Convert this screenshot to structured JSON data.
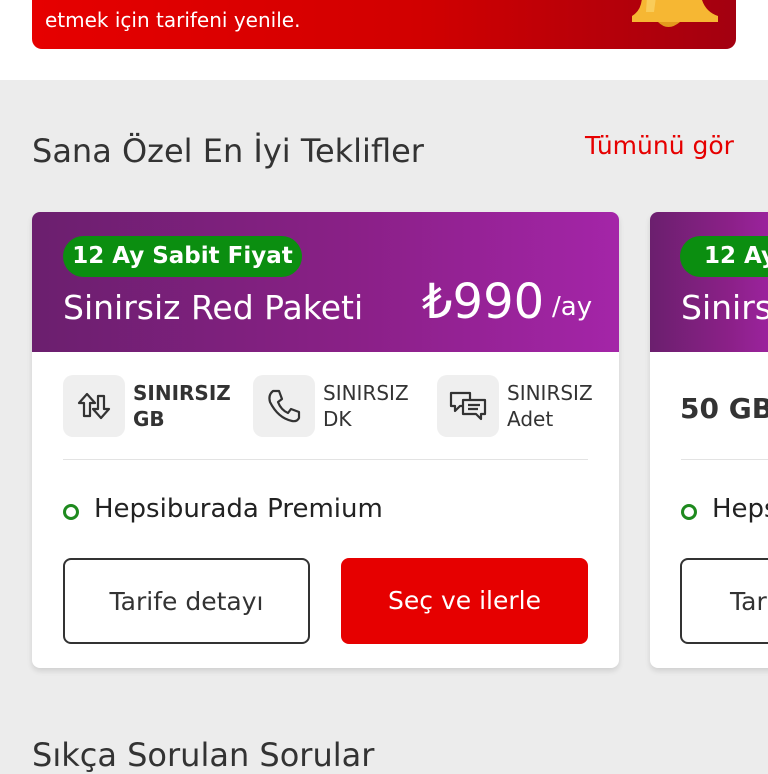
{
  "banner": {
    "text": "etmek için tarifeni yenile."
  },
  "offers": {
    "title": "Sana Özel En İyi Teklifler",
    "see_all": "Tümünü gör",
    "cards": [
      {
        "badge": "12 Ay Sabit Fiyat",
        "name": "Sinirsiz Red Paketi",
        "price": "₺990",
        "unit": "/ay",
        "features": [
          {
            "icon": "data-arrows-icon",
            "line1": "SINIRSIZ",
            "line2": "GB"
          },
          {
            "icon": "phone-icon",
            "line1": "SINIRSIZ",
            "line2": "DK"
          },
          {
            "icon": "chat-bubbles-icon",
            "line1": "SINIRSIZ",
            "line2": "Adet"
          }
        ],
        "benefit": "Hepsiburada Premium",
        "detail_button": "Tarife detayı",
        "select_button": "Seç ve ilerle"
      },
      {
        "badge": "12 Ay",
        "name": "Sinirsi",
        "data": "50 GB",
        "benefit": "Heps",
        "detail_button": "Tar"
      }
    ]
  },
  "faq": {
    "title": "Sıkça Sorulan Sorular"
  },
  "colors": {
    "brand_red": "#e60000",
    "header_purple": "#8a2087",
    "badge_green": "#0b8e10"
  }
}
